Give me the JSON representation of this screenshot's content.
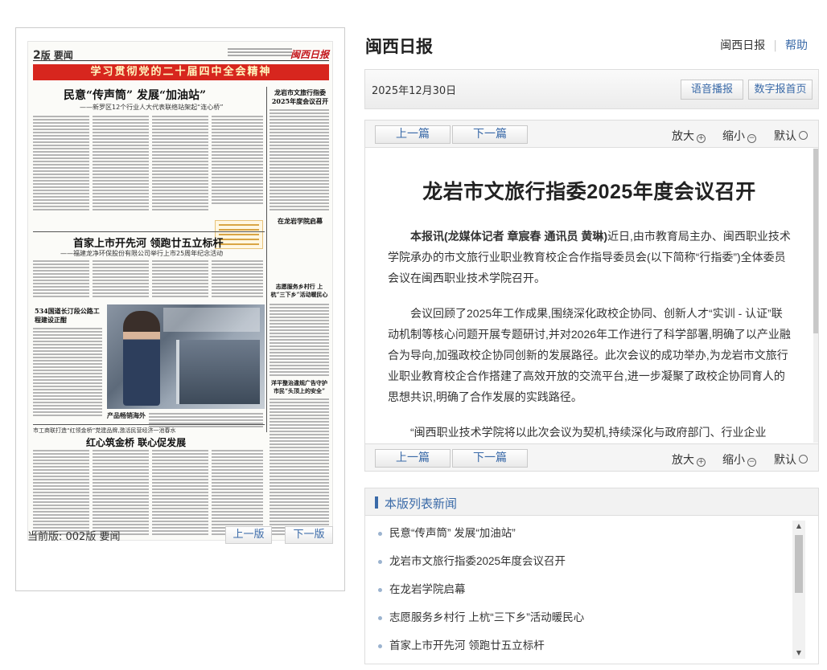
{
  "newspaper": {
    "page_no": "2",
    "page_suffix": "版 要闻",
    "logo": "闽西日报",
    "banner": "学习贯彻党的二十届四中全会精神",
    "headline1": "民意“传声筒” 发展“加油站”",
    "sub1": "——新罗区12个行业人大代表联络站架起“连心桥”",
    "side1": "龙岩市文旅行指委2025年度会议召开",
    "side2": "在龙岩学院启幕",
    "headline2": "首家上市开先河 领跑廿五立标杆",
    "sub2": "——福建龙净环保股份有限公司举行上市25周年纪念活动",
    "side3": "534国道长汀段公路工程建设正酣",
    "side4": "志愿服务乡村行 上杭“三下乡”活动暖民心",
    "side5": "洋平整治違规广告守护市民“头顶上的安全”",
    "caption": "产品畅销海外",
    "headline3": "红心筑金桥 联心促发展",
    "sub3": "市工商联打造“红领金桥”党建品牌,激活民营经济一池春水"
  },
  "left_footer": {
    "current_version": "当前版: 002版 要闻",
    "prev_page": "上一版",
    "next_page": "下一版"
  },
  "header": {
    "site_title": "闽西日报",
    "link_home": "闽西日报",
    "link_help": "帮助"
  },
  "toolbar": {
    "date": "2025年12月30日",
    "voice": "语音播报",
    "digital_home": "数字报首页"
  },
  "article_nav": {
    "prev": "上一篇",
    "next": "下一篇",
    "zoom_in": "放大",
    "zoom_out": "缩小",
    "default": "默认"
  },
  "article": {
    "title": "龙岩市文旅行指委2025年度会议召开",
    "lead_bold": "本报讯(龙媒体记者 章宸春 通讯员 黄琳)",
    "lead_rest": "近日,由市教育局主办、闽西职业技术学院承办的市文旅行业职业教育校企合作指导委员会(以下简称“行指委”)全体委员会议在闽西职业技术学院召开。",
    "para2": "会议回顾了2025年工作成果,围绕深化政校企协同、创新人才“实训 - 认证”联动机制等核心问题开展专题研讨,并对2026年工作进行了科学部署,明确了以产业融合为导向,加强政校企协同创新的发展路径。此次会议的成功举办,为龙岩市文旅行业职业教育校企合作搭建了高效开放的交流平台,进一步凝聚了政校企协同育人的思想共识,明确了合作发展的实践路径。",
    "para3": "“闽西职业技术学院将以此次会议为契机,持续深化与政府部门、行业企业"
  },
  "list": {
    "title": "本版列表新闻",
    "items": [
      "民意“传声筒” 发展“加油站”",
      "龙岩市文旅行指委2025年度会议召开",
      "在龙岩学院启幕",
      "志愿服务乡村行 上杭“三下乡”活动暖民心",
      "首家上市开先河 领跑廿五立标杆"
    ]
  }
}
